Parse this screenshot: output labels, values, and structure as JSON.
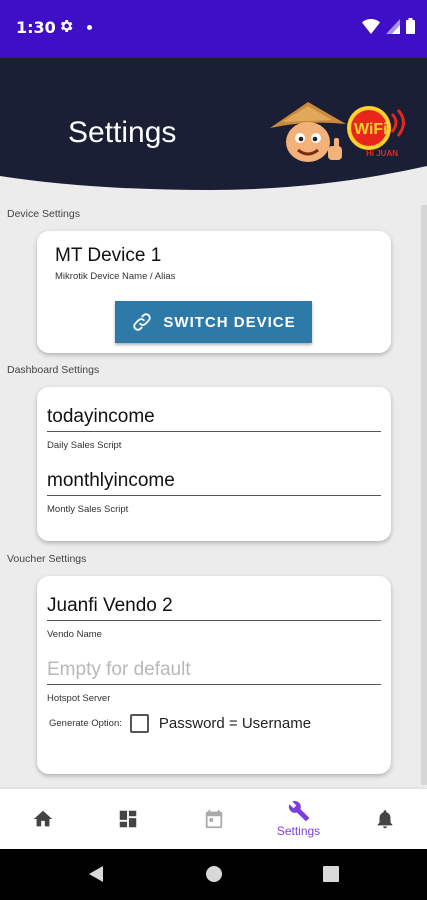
{
  "status_bar": {
    "time": "1:30",
    "color": "#3f0fc8"
  },
  "header": {
    "title": "Settings",
    "logo_text": "WiFi",
    "logo_subtext": "Hi JUAN"
  },
  "device_settings": {
    "section_label": "Device Settings",
    "device_name": "MT Device 1",
    "device_sub": "Mikrotik Device Name / Alias",
    "switch_label": "SWITCH DEVICE"
  },
  "dashboard_settings": {
    "section_label": "Dashboard Settings",
    "daily_value": "todayincome",
    "daily_helper": "Daily Sales Script",
    "monthly_value": "monthlyincome",
    "monthly_helper": "Montly Sales Script"
  },
  "voucher_settings": {
    "section_label": "Voucher Settings",
    "vendo_value": "Juanfi Vendo 2",
    "vendo_helper": "Vendo Name",
    "hotspot_placeholder": "Empty for default",
    "hotspot_helper": "Hotspot Server",
    "generate_label": "Generate Option:",
    "password_option": "Password = Username",
    "password_checked": false
  },
  "bottom_nav": {
    "items": [
      {
        "icon": "home-icon"
      },
      {
        "icon": "dashboard-icon"
      },
      {
        "icon": "calendar-icon"
      },
      {
        "icon": "wrench-icon",
        "label": "Settings",
        "active": true
      },
      {
        "icon": "bell-icon"
      }
    ],
    "active_color": "#7b3fe0"
  }
}
